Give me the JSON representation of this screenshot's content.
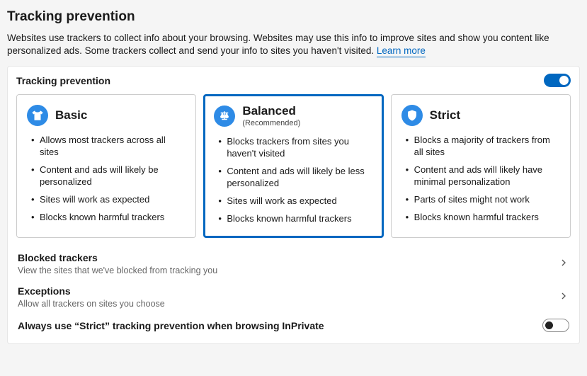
{
  "page": {
    "title": "Tracking prevention",
    "description_prefix": "Websites use trackers to collect info about your browsing. Websites may use this info to improve sites and show you content like personalized ads. Some trackers collect and send your info to sites you haven't visited. ",
    "learn_more": "Learn more"
  },
  "panel": {
    "title": "Tracking prevention",
    "toggle_on": true
  },
  "levels": [
    {
      "id": "basic",
      "title": "Basic",
      "recommended": false,
      "selected": false,
      "icon": "shirt-icon",
      "bullets": [
        "Allows most trackers across all sites",
        "Content and ads will likely be personalized",
        "Sites will work as expected",
        "Blocks known harmful trackers"
      ]
    },
    {
      "id": "balanced",
      "title": "Balanced",
      "recommended": true,
      "recommended_label": "(Recommended)",
      "selected": true,
      "icon": "scales-icon",
      "bullets": [
        "Blocks trackers from sites you haven't visited",
        "Content and ads will likely be less personalized",
        "Sites will work as expected",
        "Blocks known harmful trackers"
      ]
    },
    {
      "id": "strict",
      "title": "Strict",
      "recommended": false,
      "selected": false,
      "icon": "shield-icon",
      "bullets": [
        "Blocks a majority of trackers from all sites",
        "Content and ads will likely have minimal personalization",
        "Parts of sites might not work",
        "Blocks known harmful trackers"
      ]
    }
  ],
  "rows": {
    "blocked": {
      "title": "Blocked trackers",
      "sub": "View the sites that we've blocked from tracking you"
    },
    "exceptions": {
      "title": "Exceptions",
      "sub": "Allow all trackers on sites you choose"
    },
    "inprivate": {
      "title": "Always use “Strict” tracking prevention when browsing InPrivate",
      "toggle_on": false
    }
  }
}
